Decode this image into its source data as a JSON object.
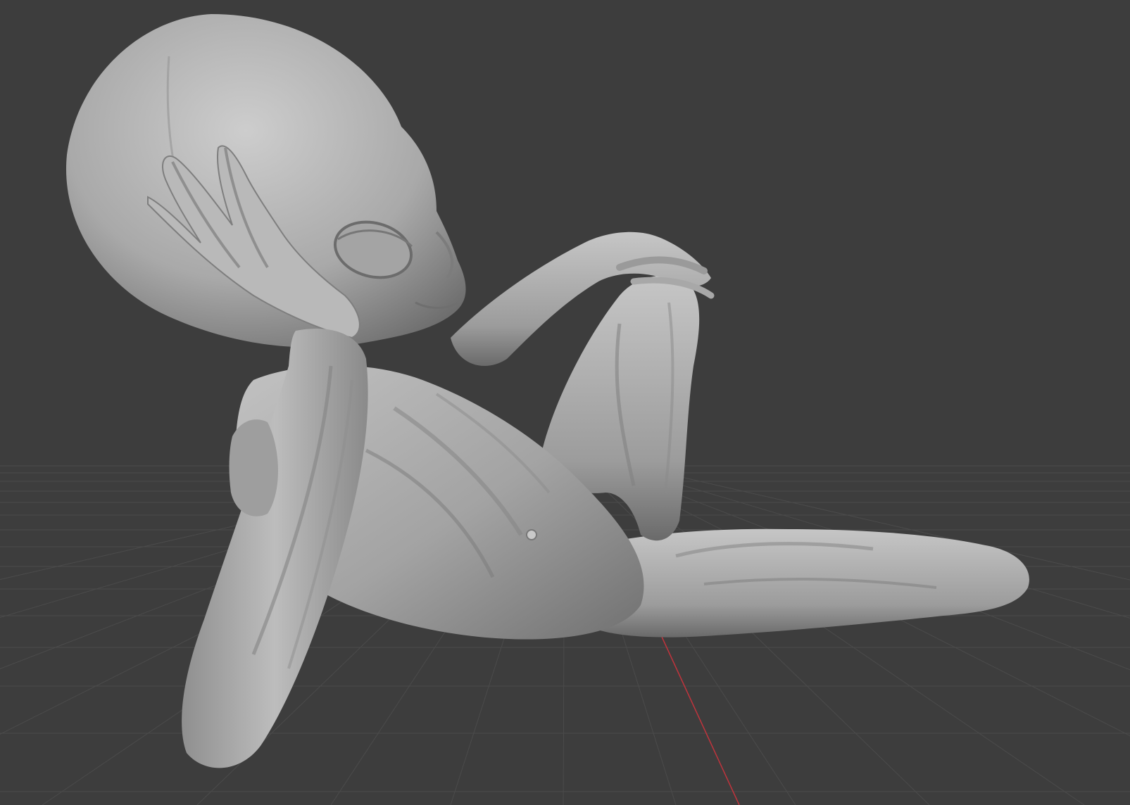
{
  "viewport": {
    "mode": "3d-viewport",
    "background_color": "#3d3d3d",
    "grid_color": "#4a4a4a",
    "axis_x_color": "#c0343d",
    "model": {
      "subject": "alien-sculpt",
      "shading": "solid-matcap-grey",
      "base_color": "#b4b4b4",
      "shadow_color": "#5c5c5c"
    }
  }
}
